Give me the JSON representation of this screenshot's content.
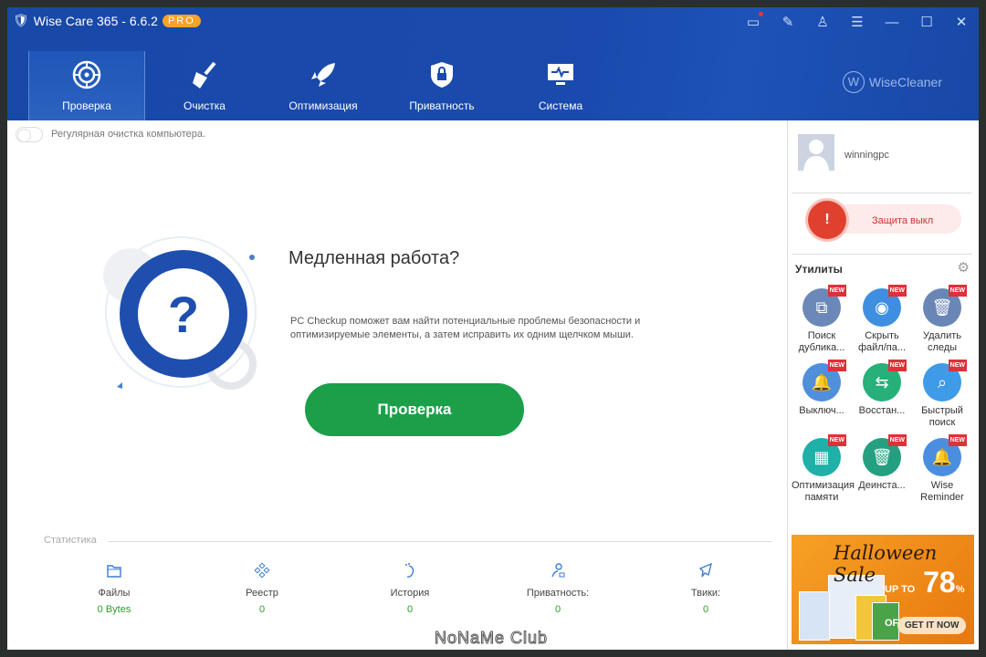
{
  "window": {
    "title": "Wise Care 365 - 6.6.2",
    "badge": "PRO",
    "brand": "WiseCleaner",
    "brand_mark": "W"
  },
  "controls": [
    {
      "icon": "feedback-icon",
      "g": "▭"
    },
    {
      "icon": "edit-icon",
      "g": "✎"
    },
    {
      "icon": "skin-icon",
      "g": "♙"
    },
    {
      "icon": "menu-icon",
      "g": "☰"
    },
    {
      "icon": "minimize-icon",
      "g": "—"
    },
    {
      "icon": "maximize-icon",
      "g": "☐"
    },
    {
      "icon": "close-icon",
      "g": "✕"
    }
  ],
  "tabs": [
    {
      "label": "Проверка",
      "active": true
    },
    {
      "label": "Очистка"
    },
    {
      "label": "Оптимизация"
    },
    {
      "label": "Приватность"
    },
    {
      "label": "Система"
    }
  ],
  "main": {
    "auto_clean_label": "Регулярная очистка компьютера.",
    "auto_clean_on": false,
    "heading": "Медленная работа?",
    "description": "PC Checkup поможет вам найти потенциальные проблемы безопасности и оптимизируемые элементы, а затем исправить их одним щелчком мыши.",
    "hero_mark": "?",
    "scan_button": "Проверка"
  },
  "stats": {
    "title": "Статистика",
    "items": [
      {
        "label": "Файлы",
        "value": "0 Bytes"
      },
      {
        "label": "Реестр",
        "value": "0"
      },
      {
        "label": "История",
        "value": "0"
      },
      {
        "label": "Приватность:",
        "value": "0"
      },
      {
        "label": "Твики:",
        "value": "0"
      }
    ]
  },
  "watermark": "NoNaMe Club",
  "side": {
    "username": "winningpc",
    "protection": "Защита выкл",
    "utilities_title": "Утилиты",
    "new_badge": "NEW",
    "utilities": [
      {
        "label": "Поиск дублика...",
        "color": "#6c88b8",
        "g": "⧉"
      },
      {
        "label": "Скрыть файл/па...",
        "color": "#3f8fe0",
        "g": "◉"
      },
      {
        "label": "Удалить следы",
        "color": "#6a86b6",
        "g": "🗑"
      },
      {
        "label": "Выключ...",
        "color": "#4f8fdc",
        "g": "🔔"
      },
      {
        "label": "Восстан...",
        "color": "#27b07a",
        "g": "⇆"
      },
      {
        "label": "Быстрый поиск",
        "color": "#3f9ae8",
        "g": "⌕"
      },
      {
        "label": "Оптимизация памяти",
        "color": "#1fb0a8",
        "g": "▦"
      },
      {
        "label": "Деинста...",
        "color": "#24a080",
        "g": "🗑"
      },
      {
        "label": "Wise Reminder",
        "color": "#4a8ee0",
        "g": "🔔"
      }
    ]
  },
  "ad": {
    "title": "Halloween Sale",
    "discount_prefix": "UP TO",
    "discount": "78",
    "discount_suffix": "% OFF",
    "cta": "GET IT NOW"
  }
}
